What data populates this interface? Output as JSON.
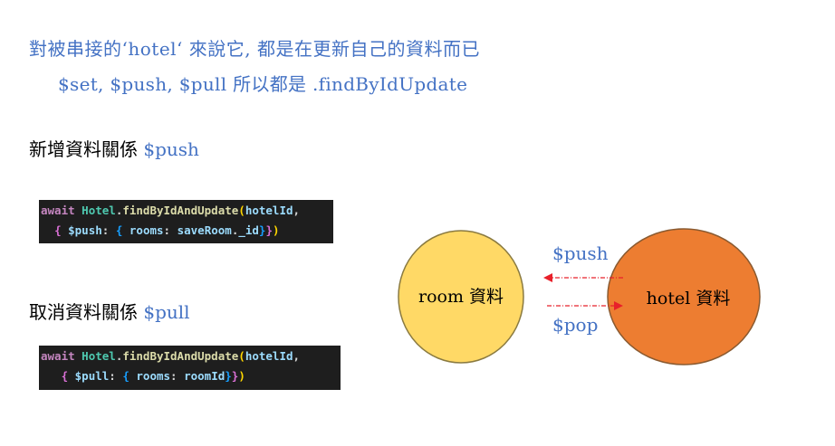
{
  "intro": {
    "line1": "對被串接的‘hotel‘ 來說它, 都是在更新自己的資料而已",
    "line2": "$set, $push, $pull 所以都是 .findByIdUpdate"
  },
  "sections": {
    "push": {
      "heading": "新增資料關係",
      "operator": "$push",
      "code": {
        "kw_await": "await",
        "class_name": "Hotel",
        "dot": ".",
        "method": "findByIdAndUpdate",
        "open_paren": "(",
        "arg1": "hotelId",
        "comma": ",",
        "open_brace": "{",
        "key": "$push",
        "colon": ":",
        "inner_open": "{",
        "inner_key": "rooms",
        "inner_colon": ":",
        "inner_value_obj": "saveRoom",
        "inner_value_dot": ".",
        "inner_value_prop": "_id",
        "inner_close": "}",
        "close_brace": "}",
        "close_paren": ")"
      }
    },
    "pull": {
      "heading": "取消資料關係",
      "operator": "$pull",
      "code": {
        "kw_await": "await",
        "class_name": "Hotel",
        "dot": ".",
        "method": "findByIdAndUpdate",
        "open_paren": "(",
        "arg1": "hotelId",
        "comma": ",",
        "open_brace": "{",
        "key": "$pull",
        "colon": ":",
        "inner_open": "{",
        "inner_key": "rooms",
        "inner_colon": ":",
        "inner_value": "roomId",
        "inner_close": "}",
        "close_brace": "}",
        "close_paren": ")"
      }
    }
  },
  "diagram": {
    "room_label": "room 資料",
    "hotel_label": "hotel 資料",
    "push_label": "$push",
    "pop_label": "$pop",
    "room_color": "#ffd966",
    "room_stroke": "#8a7a40",
    "hotel_color": "#ed7d31",
    "hotel_stroke": "#8a5a30",
    "arrow_color": "#e8202a"
  }
}
